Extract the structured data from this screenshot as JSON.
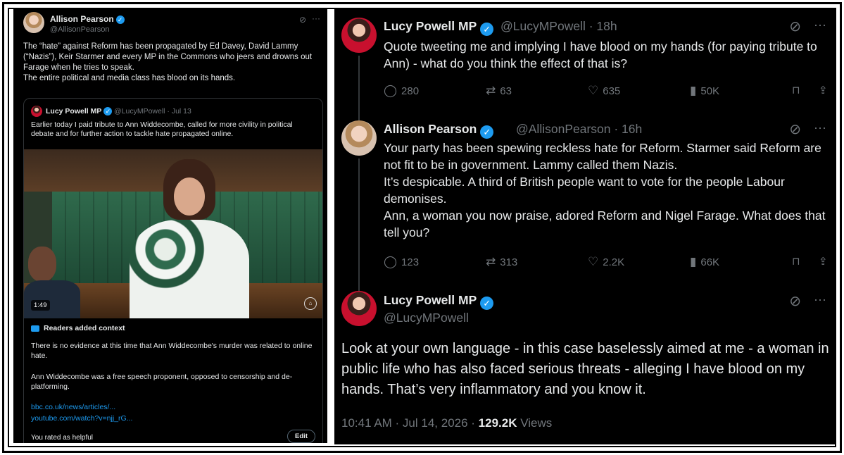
{
  "left_tweet": {
    "author_name": "Allison Pearson",
    "author_handle": "@AllisonPearson",
    "body": "The “hate” against Reform has been propagated by Ed Davey, David Lammy (“Nazis”), Keir Starmer and every MP in the Commons who jeers and drowns out Farage when he tries to speak.\n  The entire political and media class has blood on its hands.",
    "quoted": {
      "author_name": "Lucy Powell MP",
      "author_handle": "@LucyMPowell · Jul 13",
      "body": "Earlier today I paid tribute to Ann Widdecombe, called for more civility in political debate and for further action to tackle hate propagated online.",
      "video_duration": "1:49"
    },
    "context": {
      "title": "Readers added context",
      "p1": "There is no evidence at this time that Ann Widdecombe's murder was related to online hate.",
      "p2": "Ann Widdecombe was a free speech proponent, opposed to censorship and de-platforming.",
      "link1": "bbc.co.uk/news/articles/...",
      "link2": "youtube.com/watch?v=njj_rG...",
      "rated": "You rated as helpful",
      "edit_label": "Edit"
    }
  },
  "right_thread": [
    {
      "author_name": "Lucy Powell MP",
      "author_handle": "@LucyMPowell · 18h",
      "body": "Quote tweeting me and implying I have blood on my hands (for paying tribute to Ann) - what do you think the effect of that is?",
      "replies": "280",
      "reposts": "63",
      "likes": "635",
      "views": "50K"
    },
    {
      "author_name": "Allison Pearson",
      "author_handle": "@AllisonPearson · 16h",
      "body": "Your party has been spewing reckless hate for Reform. Starmer said Reform are not fit to be in government. Lammy called them Nazis.\n It’s despicable. A third of British people want to vote for the people Labour demonises.\n Ann, a woman you now praise, adored Reform and Nigel Farage. What does that tell you?",
      "replies": "123",
      "reposts": "313",
      "likes": "2.2K",
      "views": "66K"
    }
  ],
  "main_tweet": {
    "author_name": "Lucy Powell MP",
    "author_handle": "@LucyMPowell",
    "body": "Look at your own language - in this case baselessly aimed at me - a woman in public life who has also faced serious threats - alleging I have blood on my hands. That’s very inflammatory and you know it.",
    "timestamp": "10:41 AM · Jul 14, 2026 · ",
    "views_count": "129.2K",
    "views_label": " Views"
  },
  "icons": [
    "verified-icon",
    "grok-icon",
    "more-icon",
    "reply-icon",
    "repost-icon",
    "like-icon",
    "views-icon",
    "bookmark-icon",
    "share-icon",
    "context-icon"
  ],
  "colors": {
    "background": "#000000",
    "text": "#e7e9ea",
    "muted": "#71767b",
    "accent": "#1d9bf0"
  }
}
